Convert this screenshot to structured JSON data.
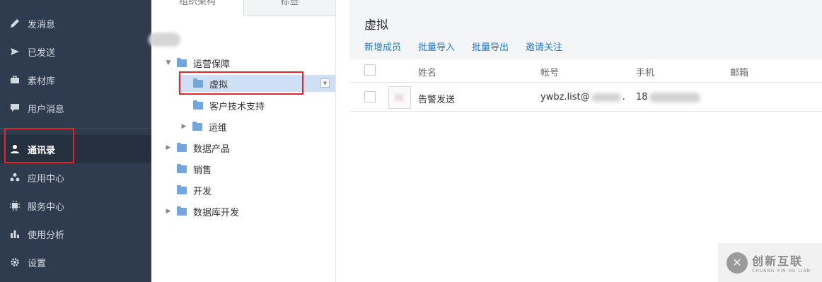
{
  "sidebar": {
    "items": [
      {
        "label": "发消息",
        "icon": "pencil-icon"
      },
      {
        "label": "已发送",
        "icon": "send-icon"
      },
      {
        "label": "素材库",
        "icon": "briefcase-icon"
      },
      {
        "label": "用户消息",
        "icon": "chat-icon"
      },
      {
        "label": "通讯录",
        "icon": "user-icon"
      },
      {
        "label": "应用中心",
        "icon": "apps-icon"
      },
      {
        "label": "服务中心",
        "icon": "chip-icon"
      },
      {
        "label": "使用分析",
        "icon": "bar-chart-icon"
      },
      {
        "label": "设置",
        "icon": "gear-icon"
      }
    ],
    "active": "通讯录"
  },
  "tree": {
    "tabs": [
      "组织架构",
      "标签"
    ],
    "nodes": [
      {
        "label": "运营保障",
        "expanded": true
      },
      {
        "label": "虚拟",
        "selected": true
      },
      {
        "label": "客户技术支持"
      },
      {
        "label": "运维",
        "collapsed": true
      },
      {
        "label": "数据产品",
        "collapsed": true
      },
      {
        "label": "销售"
      },
      {
        "label": "开发"
      },
      {
        "label": "数据库开发",
        "collapsed": true
      }
    ]
  },
  "main": {
    "title": "虚拟",
    "actions": [
      "新增成员",
      "批量导入",
      "批量导出",
      "邀请关注"
    ],
    "columns": [
      "姓名",
      "帐号",
      "手机",
      "邮箱"
    ],
    "rows": [
      {
        "name": "告警发送",
        "account": "ywbz.list@",
        "account_tail": ".",
        "phone": "18"
      }
    ]
  },
  "watermark": {
    "text": "创新互联",
    "sub": "CHUANG XIN HU LIAN"
  },
  "colors": {
    "sidebar_bg": "#2f3c4f",
    "link": "#2a7ac0",
    "highlight": "#e0262e"
  }
}
